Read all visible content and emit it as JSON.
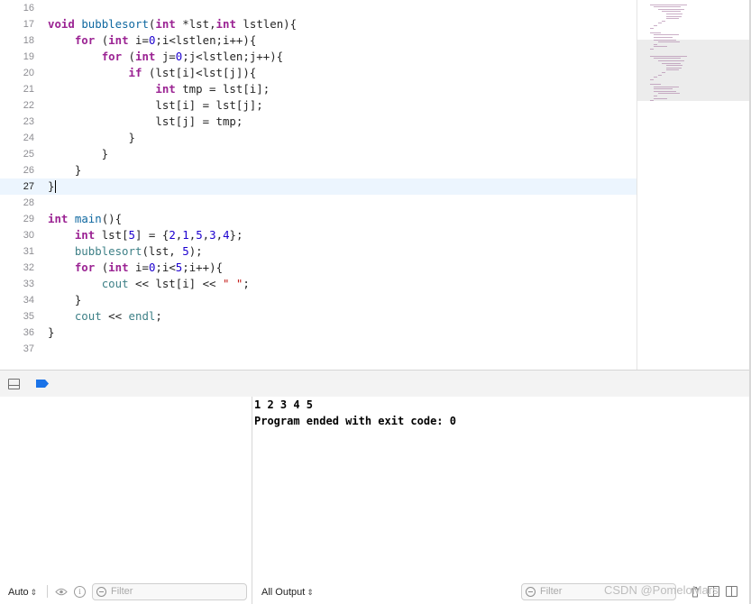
{
  "editor": {
    "current_line": 27,
    "lines": [
      {
        "num": "16",
        "tokens": []
      },
      {
        "num": "17",
        "tokens": [
          {
            "t": "void",
            "c": "kw"
          },
          {
            "t": " "
          },
          {
            "t": "bubblesort",
            "c": "fn"
          },
          {
            "t": "("
          },
          {
            "t": "int",
            "c": "kw"
          },
          {
            "t": " *lst,"
          },
          {
            "t": "int",
            "c": "kw"
          },
          {
            "t": " lstlen){"
          }
        ]
      },
      {
        "num": "18",
        "tokens": [
          {
            "t": "    "
          },
          {
            "t": "for",
            "c": "kw"
          },
          {
            "t": " ("
          },
          {
            "t": "int",
            "c": "kw"
          },
          {
            "t": " i="
          },
          {
            "t": "0",
            "c": "num"
          },
          {
            "t": ";i<lstlen;i++){"
          }
        ]
      },
      {
        "num": "19",
        "tokens": [
          {
            "t": "        "
          },
          {
            "t": "for",
            "c": "kw"
          },
          {
            "t": " ("
          },
          {
            "t": "int",
            "c": "kw"
          },
          {
            "t": " j="
          },
          {
            "t": "0",
            "c": "num"
          },
          {
            "t": ";j<lstlen;j++){"
          }
        ]
      },
      {
        "num": "20",
        "tokens": [
          {
            "t": "            "
          },
          {
            "t": "if",
            "c": "kw"
          },
          {
            "t": " (lst[i]<lst[j]){"
          }
        ]
      },
      {
        "num": "21",
        "tokens": [
          {
            "t": "                "
          },
          {
            "t": "int",
            "c": "kw"
          },
          {
            "t": " tmp = lst[i];"
          }
        ]
      },
      {
        "num": "22",
        "tokens": [
          {
            "t": "                lst[i] = lst[j];"
          }
        ]
      },
      {
        "num": "23",
        "tokens": [
          {
            "t": "                lst[j] = tmp;"
          }
        ]
      },
      {
        "num": "24",
        "tokens": [
          {
            "t": "            }"
          }
        ]
      },
      {
        "num": "25",
        "tokens": [
          {
            "t": "        }"
          }
        ]
      },
      {
        "num": "26",
        "tokens": [
          {
            "t": "    }"
          }
        ]
      },
      {
        "num": "27",
        "tokens": [
          {
            "t": "}"
          }
        ]
      },
      {
        "num": "28",
        "tokens": []
      },
      {
        "num": "29",
        "tokens": [
          {
            "t": "int",
            "c": "kw"
          },
          {
            "t": " "
          },
          {
            "t": "main",
            "c": "fn"
          },
          {
            "t": "(){"
          }
        ]
      },
      {
        "num": "30",
        "tokens": [
          {
            "t": "    "
          },
          {
            "t": "int",
            "c": "kw"
          },
          {
            "t": " lst["
          },
          {
            "t": "5",
            "c": "num"
          },
          {
            "t": "] = {"
          },
          {
            "t": "2",
            "c": "num"
          },
          {
            "t": ","
          },
          {
            "t": "1",
            "c": "num"
          },
          {
            "t": ","
          },
          {
            "t": "5",
            "c": "num"
          },
          {
            "t": ","
          },
          {
            "t": "3",
            "c": "num"
          },
          {
            "t": ","
          },
          {
            "t": "4",
            "c": "num"
          },
          {
            "t": "};"
          }
        ]
      },
      {
        "num": "31",
        "tokens": [
          {
            "t": "    "
          },
          {
            "t": "bubblesort",
            "c": "fn2"
          },
          {
            "t": "(lst, "
          },
          {
            "t": "5",
            "c": "num"
          },
          {
            "t": ");"
          }
        ]
      },
      {
        "num": "32",
        "tokens": [
          {
            "t": "    "
          },
          {
            "t": "for",
            "c": "kw"
          },
          {
            "t": " ("
          },
          {
            "t": "int",
            "c": "kw"
          },
          {
            "t": " i="
          },
          {
            "t": "0",
            "c": "num"
          },
          {
            "t": ";i<"
          },
          {
            "t": "5",
            "c": "num"
          },
          {
            "t": ";i++){"
          }
        ]
      },
      {
        "num": "33",
        "tokens": [
          {
            "t": "        "
          },
          {
            "t": "cout",
            "c": "fn2"
          },
          {
            "t": " << lst[i] << "
          },
          {
            "t": "\" \"",
            "c": "str"
          },
          {
            "t": ";"
          }
        ]
      },
      {
        "num": "34",
        "tokens": [
          {
            "t": "    }"
          }
        ]
      },
      {
        "num": "35",
        "tokens": [
          {
            "t": "    "
          },
          {
            "t": "cout",
            "c": "fn2"
          },
          {
            "t": " << "
          },
          {
            "t": "endl",
            "c": "fn2"
          },
          {
            "t": ";"
          }
        ]
      },
      {
        "num": "36",
        "tokens": [
          {
            "t": "}"
          }
        ]
      },
      {
        "num": "37",
        "tokens": []
      }
    ]
  },
  "console": {
    "output_lines": [
      "1 2 3 4 5",
      "Program ended with exit code: 0"
    ]
  },
  "variables_bar": {
    "scope_label": "Auto",
    "filter_placeholder": "Filter"
  },
  "console_bar": {
    "output_label": "All Output",
    "filter_placeholder": "Filter"
  },
  "watermark": "CSDN @PomeloMars",
  "colors": {
    "keyword": "#9b2393",
    "function": "#0f68a0",
    "call": "#3e8087",
    "number": "#1c00cf",
    "string": "#c41a16",
    "current_line_bg": "#ecf5fe",
    "breakpoint_blue": "#1a73e8"
  }
}
